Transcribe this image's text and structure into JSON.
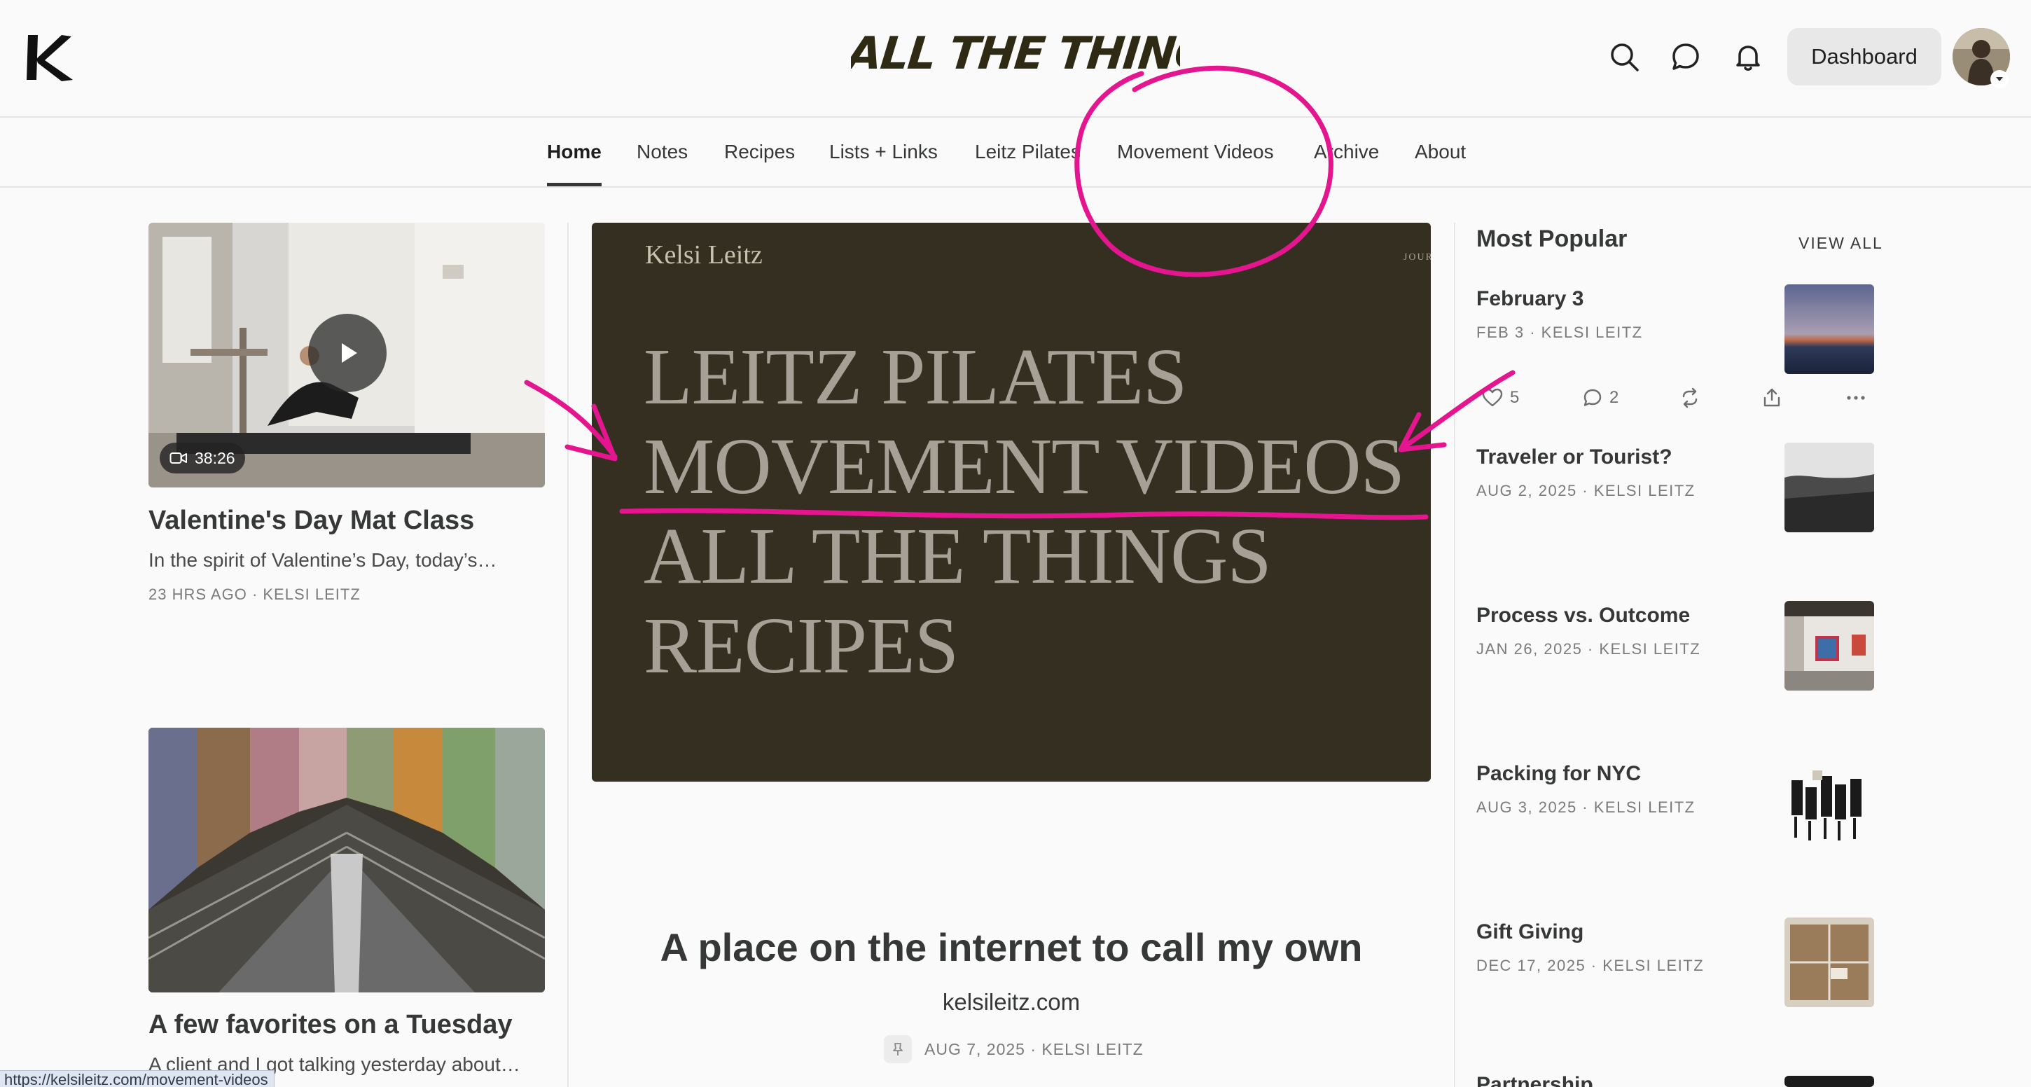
{
  "header": {
    "logo_letter": "K",
    "wordmark": "ALL THE THINGS",
    "dashboard_label": "Dashboard"
  },
  "nav": {
    "items": [
      "Home",
      "Notes",
      "Recipes",
      "Lists + Links",
      "Leitz Pilates",
      "Movement Videos",
      "Archive",
      "About"
    ],
    "active": "Home"
  },
  "left_column": {
    "posts": [
      {
        "title": "Valentine's Day Mat Class",
        "excerpt": "In the spirit of Valentine’s Day, today’s…",
        "meta": "23 HRS AGO · KELSI LEITZ",
        "duration": "38:26"
      },
      {
        "title": "A few favorites on a Tuesday",
        "excerpt": "A client and I got talking yesterday about…",
        "meta": ""
      }
    ]
  },
  "hero": {
    "brand": "Kelsi Leitz",
    "tag": "JOUR",
    "lines": [
      "LEITZ PILATES",
      "MOVEMENT VIDEOS",
      "ALL THE THINGS",
      "RECIPES"
    ]
  },
  "feature": {
    "title": "A place on the internet to call my own",
    "subtitle": "kelsileitz.com",
    "meta": "AUG 7, 2025 · KELSI LEITZ"
  },
  "sidebar": {
    "heading": "Most Popular",
    "view_all": "VIEW ALL",
    "items": [
      {
        "title": "February 3",
        "meta": "FEB 3 · KELSI LEITZ"
      },
      {
        "title": "Traveler or Tourist?",
        "meta": "AUG 2, 2025 · KELSI LEITZ"
      },
      {
        "title": "Process vs. Outcome",
        "meta": "JAN 26, 2025 · KELSI LEITZ"
      },
      {
        "title": "Packing for NYC",
        "meta": "AUG 3, 2025 · KELSI LEITZ"
      },
      {
        "title": "Gift Giving",
        "meta": "DEC 17, 2025 · KELSI LEITZ"
      },
      {
        "title": "Partnership",
        "meta": ""
      }
    ],
    "actions": {
      "likes": "5",
      "comments": "2"
    }
  },
  "status_bar": {
    "url": "https://kelsileitz.com/movement-videos"
  },
  "colors": {
    "annotation": "#e5148f",
    "hero_bg": "#352f22",
    "text": "#363737"
  }
}
